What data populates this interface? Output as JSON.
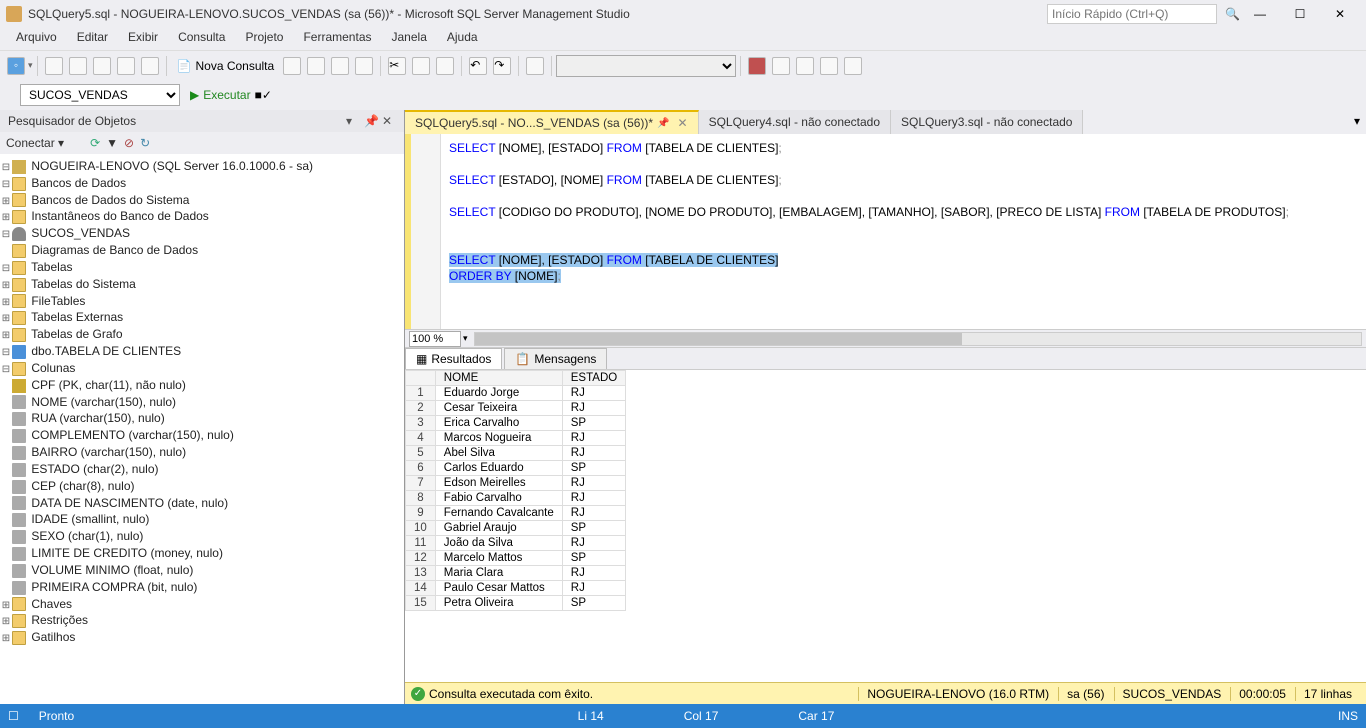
{
  "titlebar": {
    "title": "SQLQuery5.sql - NOGUEIRA-LENOVO.SUCOS_VENDAS (sa (56))* - Microsoft SQL Server Management Studio",
    "quicklaunch_placeholder": "Início Rápido (Ctrl+Q)"
  },
  "menubar": [
    "Arquivo",
    "Editar",
    "Exibir",
    "Consulta",
    "Projeto",
    "Ferramentas",
    "Janela",
    "Ajuda"
  ],
  "toolbar": {
    "novaconsulta": "Nova Consulta"
  },
  "toolbar2": {
    "database": "SUCOS_VENDAS",
    "executar": "Executar"
  },
  "objexp": {
    "title": "Pesquisador de Objetos",
    "connect": "Conectar ▾",
    "tree": [
      {
        "lvl": 1,
        "exp": "−",
        "ico": "srv",
        "label": "NOGUEIRA-LENOVO (SQL Server 16.0.1000.6 - sa)"
      },
      {
        "lvl": 2,
        "exp": "−",
        "ico": "folder",
        "label": "Bancos de Dados"
      },
      {
        "lvl": 3,
        "exp": "+",
        "ico": "folder",
        "label": "Bancos de Dados do Sistema"
      },
      {
        "lvl": 3,
        "exp": "+",
        "ico": "folder",
        "label": "Instantâneos do Banco de Dados"
      },
      {
        "lvl": 3,
        "exp": "−",
        "ico": "db",
        "label": "SUCOS_VENDAS"
      },
      {
        "lvl": 4,
        "exp": "",
        "ico": "folder",
        "label": "Diagramas de Banco de Dados"
      },
      {
        "lvl": 4,
        "exp": "−",
        "ico": "folder",
        "label": "Tabelas"
      },
      {
        "lvl": 5,
        "exp": "+",
        "ico": "folder",
        "label": "Tabelas do Sistema"
      },
      {
        "lvl": 5,
        "exp": "+",
        "ico": "folder",
        "label": "FileTables"
      },
      {
        "lvl": 5,
        "exp": "+",
        "ico": "folder",
        "label": "Tabelas Externas"
      },
      {
        "lvl": 5,
        "exp": "+",
        "ico": "folder",
        "label": "Tabelas de Grafo"
      },
      {
        "lvl": 5,
        "exp": "−",
        "ico": "table",
        "label": "dbo.TABELA DE CLIENTES"
      },
      {
        "lvl": 6,
        "exp": "−",
        "ico": "folder",
        "label": "Colunas"
      },
      {
        "lvl": 7,
        "exp": "",
        "ico": "key",
        "label": "CPF (PK, char(11), não nulo)"
      },
      {
        "lvl": 7,
        "exp": "",
        "ico": "col",
        "label": "NOME (varchar(150), nulo)"
      },
      {
        "lvl": 7,
        "exp": "",
        "ico": "col",
        "label": "RUA (varchar(150), nulo)"
      },
      {
        "lvl": 7,
        "exp": "",
        "ico": "col",
        "label": "COMPLEMENTO (varchar(150), nulo)"
      },
      {
        "lvl": 7,
        "exp": "",
        "ico": "col",
        "label": "BAIRRO (varchar(150), nulo)"
      },
      {
        "lvl": 7,
        "exp": "",
        "ico": "col",
        "label": "ESTADO (char(2), nulo)"
      },
      {
        "lvl": 7,
        "exp": "",
        "ico": "col",
        "label": "CEP (char(8), nulo)"
      },
      {
        "lvl": 7,
        "exp": "",
        "ico": "col",
        "label": "DATA DE NASCIMENTO (date, nulo)"
      },
      {
        "lvl": 7,
        "exp": "",
        "ico": "col",
        "label": "IDADE (smallint, nulo)"
      },
      {
        "lvl": 7,
        "exp": "",
        "ico": "col",
        "label": "SEXO (char(1), nulo)"
      },
      {
        "lvl": 7,
        "exp": "",
        "ico": "col",
        "label": "LIMITE DE CREDITO (money, nulo)"
      },
      {
        "lvl": 7,
        "exp": "",
        "ico": "col",
        "label": "VOLUME MINIMO (float, nulo)"
      },
      {
        "lvl": 7,
        "exp": "",
        "ico": "col",
        "label": "PRIMEIRA COMPRA (bit, nulo)"
      },
      {
        "lvl": 6,
        "exp": "+",
        "ico": "folder",
        "label": "Chaves"
      },
      {
        "lvl": 6,
        "exp": "+",
        "ico": "folder",
        "label": "Restrições"
      },
      {
        "lvl": 6,
        "exp": "+",
        "ico": "folder",
        "label": "Gatilhos"
      }
    ]
  },
  "tabs": [
    {
      "label": "SQLQuery5.sql - NO...S_VENDAS (sa (56))*",
      "active": true
    },
    {
      "label": "SQLQuery4.sql - não conectado",
      "active": false
    },
    {
      "label": "SQLQuery3.sql - não conectado",
      "active": false
    }
  ],
  "editor": {
    "lines": [
      {
        "type": "sql",
        "text": "SELECT [NOME], [ESTADO] FROM [TABELA DE CLIENTES];"
      },
      {
        "type": "blank",
        "text": ""
      },
      {
        "type": "sql",
        "text": "SELECT [ESTADO], [NOME] FROM [TABELA DE CLIENTES];"
      },
      {
        "type": "blank",
        "text": ""
      },
      {
        "type": "sql2",
        "text": "SELECT [CODIGO DO PRODUTO], [NOME DO PRODUTO], [EMBALAGEM], [TAMANHO], [SABOR], [PRECO DE LISTA] FROM [TABELA DE PRODUTOS];"
      },
      {
        "type": "blank",
        "text": ""
      },
      {
        "type": "blank",
        "text": ""
      },
      {
        "type": "sel1",
        "text": "SELECT [NOME], [ESTADO] FROM [TABELA DE CLIENTES]"
      },
      {
        "type": "sel2",
        "text": "ORDER BY [NOME];"
      }
    ],
    "zoom": "100 %"
  },
  "restabs": {
    "resultados": "Resultados",
    "mensagens": "Mensagens"
  },
  "results": {
    "headers": [
      "NOME",
      "ESTADO"
    ],
    "rows": [
      [
        "Eduardo Jorge",
        "RJ"
      ],
      [
        "Cesar Teixeira",
        "RJ"
      ],
      [
        "Erica Carvalho",
        "SP"
      ],
      [
        "Marcos Nogueira",
        "RJ"
      ],
      [
        "Abel Silva",
        "RJ"
      ],
      [
        "Carlos Eduardo",
        "SP"
      ],
      [
        "Edson Meirelles",
        "RJ"
      ],
      [
        "Fabio Carvalho",
        "RJ"
      ],
      [
        "Fernando Cavalcante",
        "RJ"
      ],
      [
        "Gabriel Araujo",
        "SP"
      ],
      [
        "João da Silva",
        "RJ"
      ],
      [
        "Marcelo Mattos",
        "SP"
      ],
      [
        "Maria Clara",
        "RJ"
      ],
      [
        "Paulo Cesar Mattos",
        "RJ"
      ],
      [
        "Petra Oliveira",
        "SP"
      ]
    ]
  },
  "status_editor": {
    "msg": "Consulta executada com êxito.",
    "server": "NOGUEIRA-LENOVO (16.0 RTM)",
    "user": "sa (56)",
    "db": "SUCOS_VENDAS",
    "time": "00:00:05",
    "rows": "17 linhas"
  },
  "statusbar": {
    "pronto": "Pronto",
    "li": "Li 14",
    "col": "Col 17",
    "car": "Car 17",
    "ins": "INS"
  }
}
